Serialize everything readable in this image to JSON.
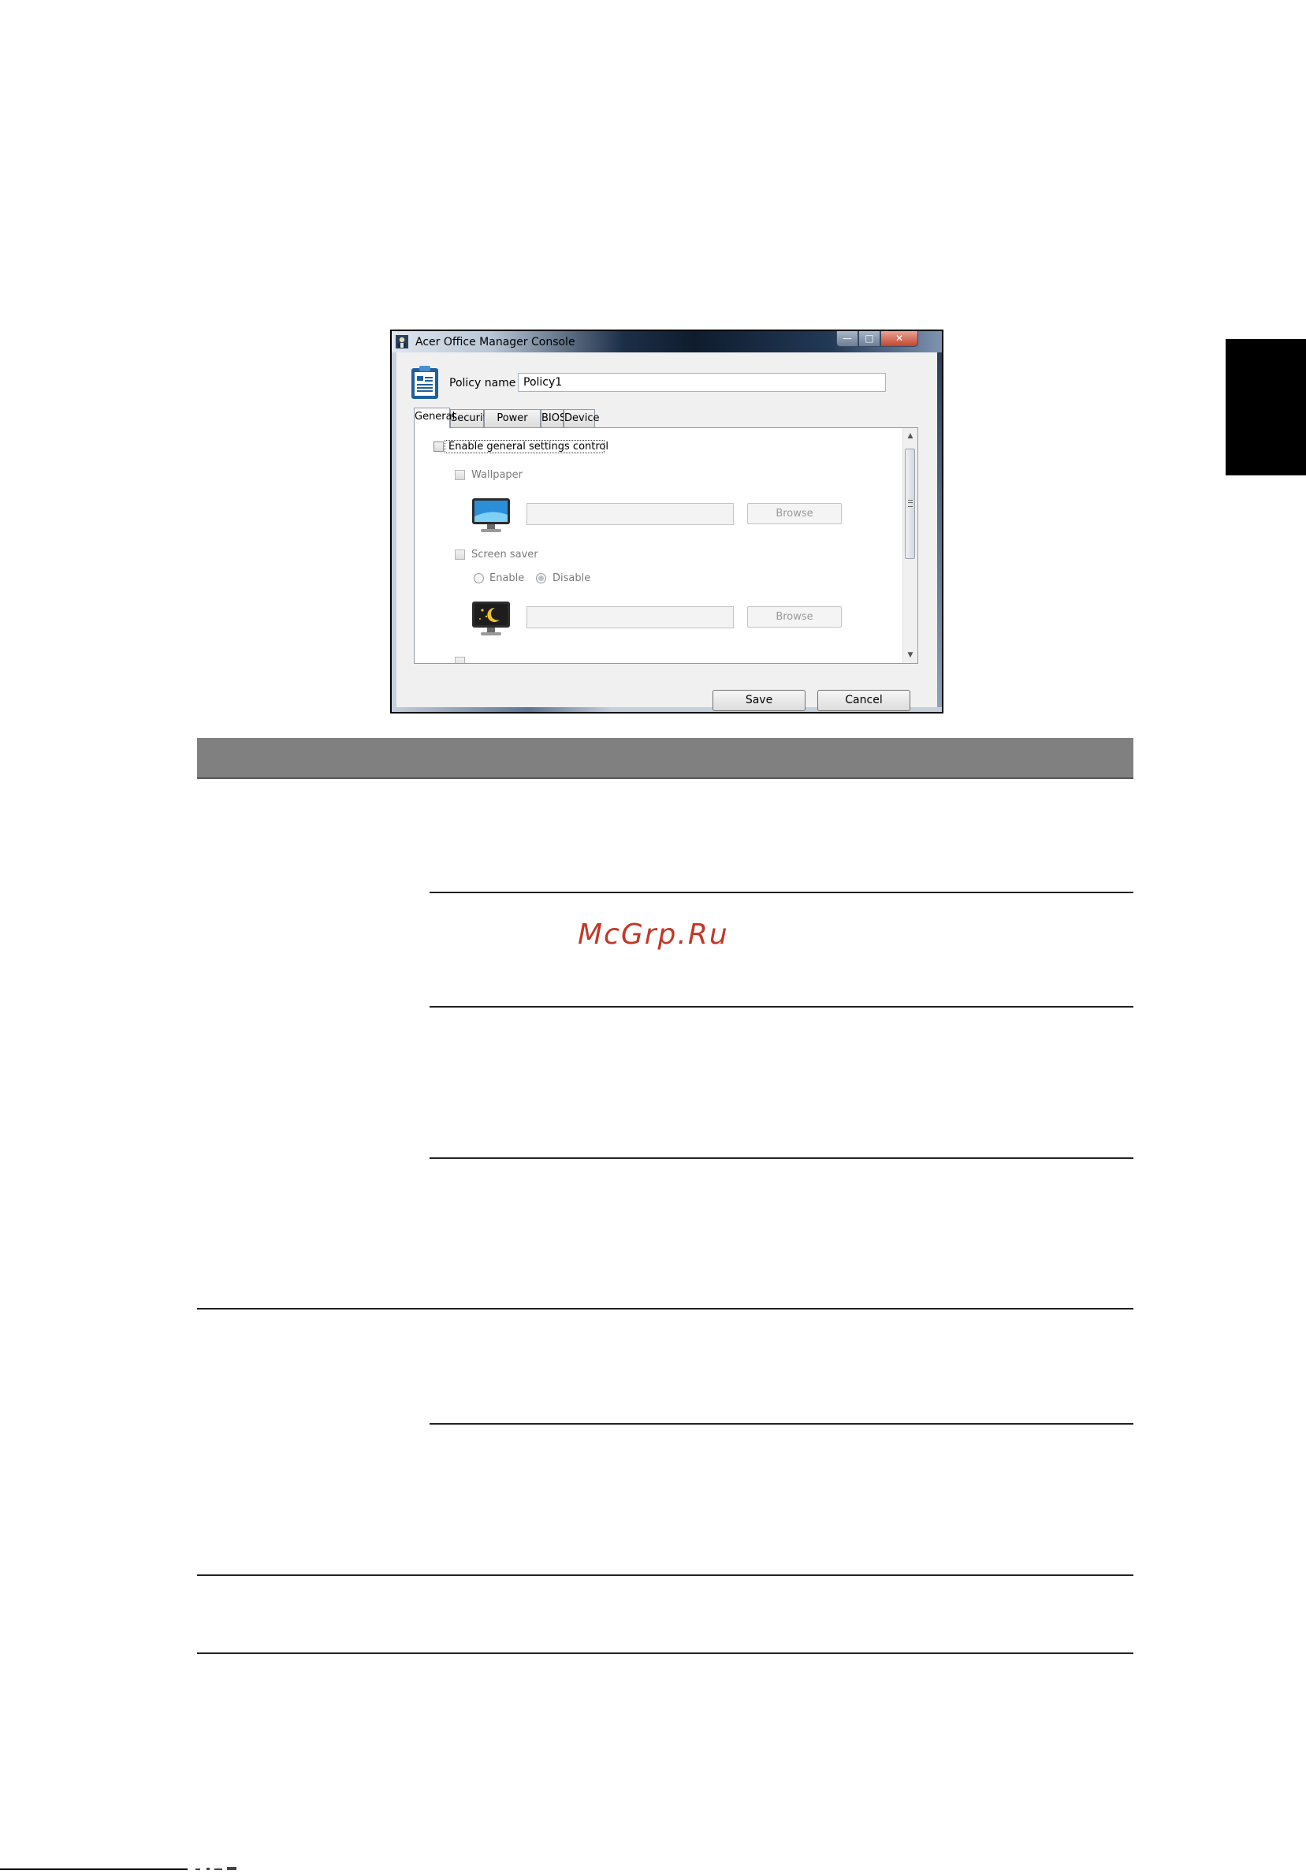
{
  "dialog": {
    "title": "Acer Office Manager Console",
    "policy_label": "Policy name",
    "policy_value": "Policy1",
    "tabs": [
      {
        "label": "General",
        "active": true
      },
      {
        "label": "Security",
        "active": false
      },
      {
        "label": "Power options",
        "active": false
      },
      {
        "label": "BIOS",
        "active": false
      },
      {
        "label": "Device",
        "active": false
      }
    ],
    "general": {
      "enable_label": "Enable general settings control",
      "wallpaper_label": "Wallpaper",
      "browse_label": "Browse",
      "screensaver_label": "Screen saver",
      "enable_option": "Enable",
      "disable_option": "Disable",
      "disable_selected": true
    },
    "buttons": {
      "save": "Save",
      "cancel": "Cancel"
    },
    "icons": {
      "app": "acer-app-icon",
      "policy": "clipboard-document-icon",
      "wallpaper": "monitor-wallpaper-icon",
      "screensaver": "monitor-screensaver-icon"
    }
  },
  "watermark": "McGrp.Ru",
  "colors": {
    "table_header": "#808080",
    "side_tab": "#000000",
    "watermark": "#c0392b"
  }
}
